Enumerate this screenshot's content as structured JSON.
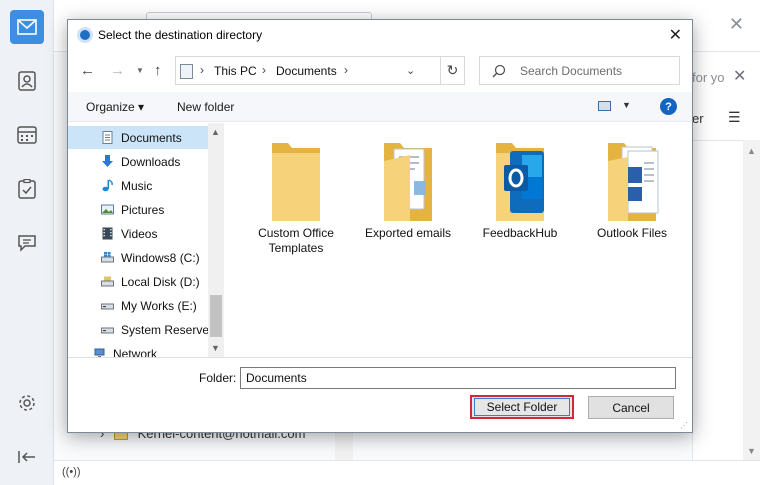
{
  "dialog": {
    "title": "Select the destination directory",
    "close_glyph": "✕"
  },
  "address_bar": {
    "crumbs": [
      "This PC",
      "Documents"
    ],
    "separator": "›"
  },
  "search": {
    "placeholder": "Search Documents"
  },
  "toolbar": {
    "organize_label": "Organize ▾",
    "new_folder_label": "New folder",
    "help_label": "?"
  },
  "nav_pane": {
    "items": [
      {
        "label": "Documents",
        "icon": "documents-icon",
        "selected": true
      },
      {
        "label": "Downloads",
        "icon": "downloads-icon"
      },
      {
        "label": "Music",
        "icon": "music-icon"
      },
      {
        "label": "Pictures",
        "icon": "pictures-icon"
      },
      {
        "label": "Videos",
        "icon": "videos-icon"
      },
      {
        "label": "Windows8 (C:)",
        "icon": "drive-c-icon"
      },
      {
        "label": "Local Disk (D:)",
        "icon": "drive-icon"
      },
      {
        "label": "My Works (E:)",
        "icon": "drive-icon"
      },
      {
        "label": "System Reserved",
        "icon": "drive-icon"
      },
      {
        "label": "Network",
        "icon": "network-icon"
      }
    ]
  },
  "files": [
    {
      "label": "Custom Office Templates",
      "icon": "folder-icon"
    },
    {
      "label": "Exported emails",
      "icon": "folder-documents-icon"
    },
    {
      "label": "FeedbackHub",
      "icon": "folder-outlook-icon"
    },
    {
      "label": "Outlook Files",
      "icon": "folder-word-icon"
    }
  ],
  "footer": {
    "folder_label": "Folder:",
    "folder_value": "Documents",
    "select_label": "Select Folder",
    "cancel_label": "Cancel"
  },
  "background_app": {
    "peek_text": "for yo",
    "peek_text2": "er",
    "tree_row": "Kernel-content@hotmail.com",
    "close_glyph": "✕"
  },
  "colors": {
    "accent": "#3b8ee0",
    "selection": "#cce4f7",
    "highlight_border": "#d12a36",
    "folder_yellow": "#f3cc61",
    "outlook_blue": "#0f6cbd"
  }
}
